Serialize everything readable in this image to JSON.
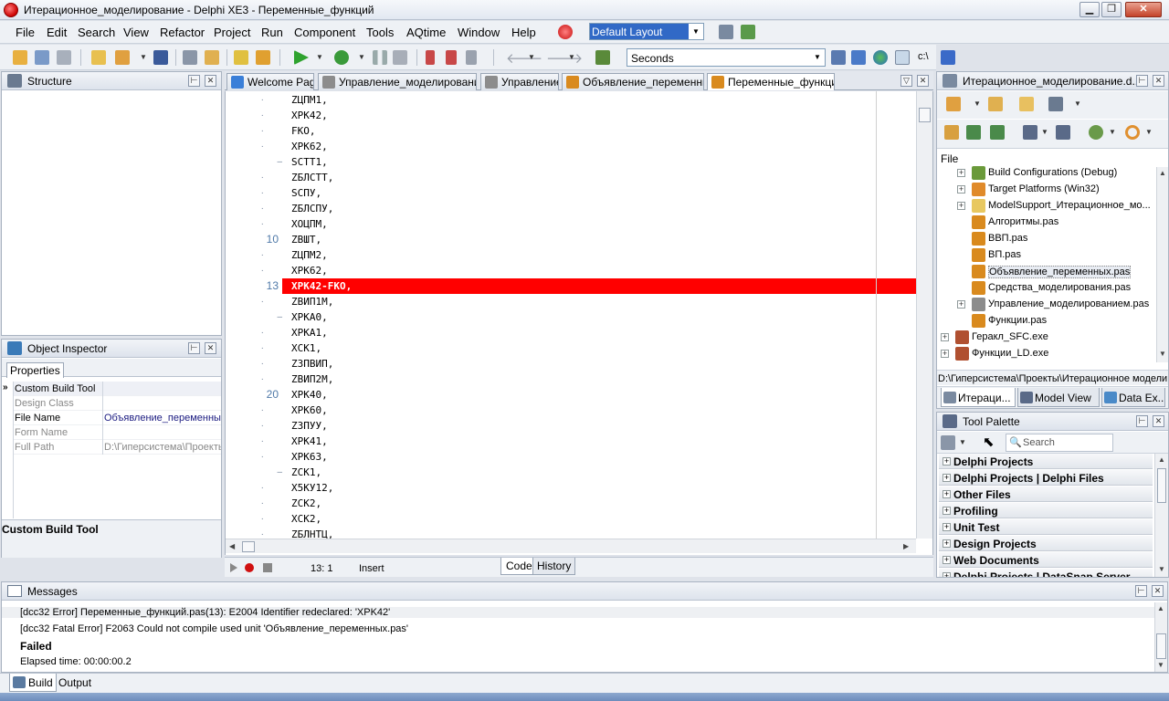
{
  "window": {
    "title": "Итерационное_моделирование - Delphi XE3 - Переменные_функций",
    "buttons": {
      "minimize": "▁",
      "maximize": "❐",
      "close": "✕"
    }
  },
  "menu": [
    {
      "label": "File"
    },
    {
      "label": "Edit"
    },
    {
      "label": "Search"
    },
    {
      "label": "View"
    },
    {
      "label": "Refactor"
    },
    {
      "label": "Project"
    },
    {
      "label": "Run"
    },
    {
      "label": "Component"
    },
    {
      "label": "Tools"
    },
    {
      "label": "AQtime"
    },
    {
      "label": "Window"
    },
    {
      "label": "Help"
    }
  ],
  "layout_combo": {
    "value": "Default Layout"
  },
  "toolbar": {
    "units_value": "Seconds"
  },
  "structure": {
    "title": "Structure"
  },
  "object_inspector": {
    "title": "Object Inspector",
    "tab": "Properties",
    "rows": [
      {
        "key": "Custom Build Tool",
        "value": ""
      },
      {
        "key": "Design Class",
        "value": ""
      },
      {
        "key": "File Name",
        "value": "Объявление_переменных"
      },
      {
        "key": "Form Name",
        "value": ""
      },
      {
        "key": "Full Path",
        "value": "D:\\Гиперсистема\\Проекты"
      }
    ],
    "description": "Custom Build Tool"
  },
  "editor_tabs": [
    {
      "label": "Welcome Page",
      "color": "#3a7fd8"
    },
    {
      "label": "Управление_моделированием",
      "color": "#8c8c8c"
    },
    {
      "label": "Управление",
      "color": "#8c8c8c"
    },
    {
      "label": "Объявление_переменных",
      "color": "#d98a1e"
    },
    {
      "label": "Переменные_функций",
      "color": "#d98a1e"
    }
  ],
  "code": {
    "lines": [
      {
        "n": "",
        "m": "·",
        "text": "ZЦПМ1,"
      },
      {
        "n": "",
        "m": "·",
        "text": "XPK42,"
      },
      {
        "n": "",
        "m": "·",
        "text": "FKO,"
      },
      {
        "n": "",
        "m": "·",
        "text": "XPK62,"
      },
      {
        "n": "",
        "m": "–",
        "text": "SCTT1,"
      },
      {
        "n": "",
        "m": "·",
        "text": "ZБЛСТТ,"
      },
      {
        "n": "",
        "m": "·",
        "text": "SСПУ,"
      },
      {
        "n": "",
        "m": "·",
        "text": "ZБЛСПУ,"
      },
      {
        "n": "",
        "m": "·",
        "text": "XOЦПМ,"
      },
      {
        "n": "10",
        "m": "",
        "text": "ZВШТ,"
      },
      {
        "n": "",
        "m": "·",
        "text": "ZЦПМ2,"
      },
      {
        "n": "",
        "m": "·",
        "text": "XPK62,"
      },
      {
        "n": "13",
        "m": "",
        "text": "XPK42-FKO,"
      },
      {
        "n": "",
        "m": "·",
        "text": "ZВИП1М,"
      },
      {
        "n": "",
        "m": "–",
        "text": "XPKA0,"
      },
      {
        "n": "",
        "m": "·",
        "text": "XPKA1,"
      },
      {
        "n": "",
        "m": "·",
        "text": "XCK1,"
      },
      {
        "n": "",
        "m": "·",
        "text": "ZЗПВИП,"
      },
      {
        "n": "",
        "m": "·",
        "text": "ZВИП2М,"
      },
      {
        "n": "20",
        "m": "",
        "text": "XPK40,"
      },
      {
        "n": "",
        "m": "·",
        "text": "XPK60,"
      },
      {
        "n": "",
        "m": "·",
        "text": "ZЗПУУ,"
      },
      {
        "n": "",
        "m": "·",
        "text": "XPK41,"
      },
      {
        "n": "",
        "m": "·",
        "text": "XPK63,"
      },
      {
        "n": "",
        "m": "–",
        "text": "ZCK1,"
      },
      {
        "n": "",
        "m": "·",
        "text": "X5КУ12,"
      },
      {
        "n": "",
        "m": "·",
        "text": "ZCK2,"
      },
      {
        "n": "",
        "m": "·",
        "text": "XCK2,"
      },
      {
        "n": "",
        "m": "·",
        "text": "ZБЛНТЦ,"
      }
    ],
    "highlight_line": 13
  },
  "status": {
    "position": "13:  1",
    "mode": "Insert",
    "tab_code": "Code",
    "tab_history": "History"
  },
  "project": {
    "title": "Итерационное_моделирование.d...",
    "column": "File",
    "nodes": [
      {
        "label": "Build Configurations (Debug)",
        "indent": 2,
        "expander": "+",
        "color": "#6a9a3a"
      },
      {
        "label": "Target Platforms (Win32)",
        "indent": 2,
        "expander": "+",
        "color": "#e08a2a"
      },
      {
        "label": "ModelSupport_Итерационное_мо...",
        "indent": 2,
        "expander": "+",
        "color": "#e8c860"
      },
      {
        "label": "Алгоритмы.pas",
        "indent": 2,
        "expander": "",
        "color": "#d98a1e"
      },
      {
        "label": "ВВП.pas",
        "indent": 2,
        "expander": "",
        "color": "#d98a1e"
      },
      {
        "label": "ВП.pas",
        "indent": 2,
        "expander": "",
        "color": "#d98a1e"
      },
      {
        "label": "Объявление_переменных.pas",
        "indent": 2,
        "expander": "",
        "color": "#d98a1e"
      },
      {
        "label": "Средства_моделирования.pas",
        "indent": 2,
        "expander": "",
        "color": "#d98a1e"
      },
      {
        "label": "Управление_моделированием.pas",
        "indent": 2,
        "expander": "+",
        "color": "#8c8c8c"
      },
      {
        "label": "Функции.pas",
        "indent": 2,
        "expander": "",
        "color": "#d98a1e"
      },
      {
        "label": "Геракл_SFC.exe",
        "indent": 1,
        "expander": "+",
        "color": "#b05030"
      },
      {
        "label": "Функции_LD.exe",
        "indent": 1,
        "expander": "+",
        "color": "#b05030"
      }
    ],
    "path": "D:\\Гиперсистема\\Проекты\\Итерационное моделир",
    "tabs": [
      {
        "label": "Итераци..."
      },
      {
        "label": "Model View"
      },
      {
        "label": "Data Ex..."
      }
    ]
  },
  "palette": {
    "title": "Tool Palette",
    "search_placeholder": "Search",
    "categories": [
      {
        "label": "Delphi Projects"
      },
      {
        "label": "Delphi Projects | Delphi Files"
      },
      {
        "label": "Other Files"
      },
      {
        "label": "Profiling"
      },
      {
        "label": "Unit Test"
      },
      {
        "label": "Design Projects"
      },
      {
        "label": "Web Documents"
      },
      {
        "label": "Delphi Projects | DataSnap Server"
      }
    ]
  },
  "messages": {
    "title": "Messages",
    "lines": [
      {
        "text": "[dcc32 Error] Переменные_функций.pas(13): E2004 Identifier redeclared: 'XPK42'",
        "bold": false
      },
      {
        "text": "[dcc32 Fatal Error] F2063 Could not compile used unit 'Объявление_переменных.pas'",
        "bold": false
      },
      {
        "text": "Failed",
        "bold": true
      },
      {
        "text": "Elapsed time: 00:00:00.2",
        "bold": false
      }
    ],
    "tabs": [
      {
        "label": "Build"
      },
      {
        "label": "Output"
      }
    ]
  },
  "colors": {
    "highlight": "#ff0000",
    "line_numbers": "#4f79a8"
  }
}
